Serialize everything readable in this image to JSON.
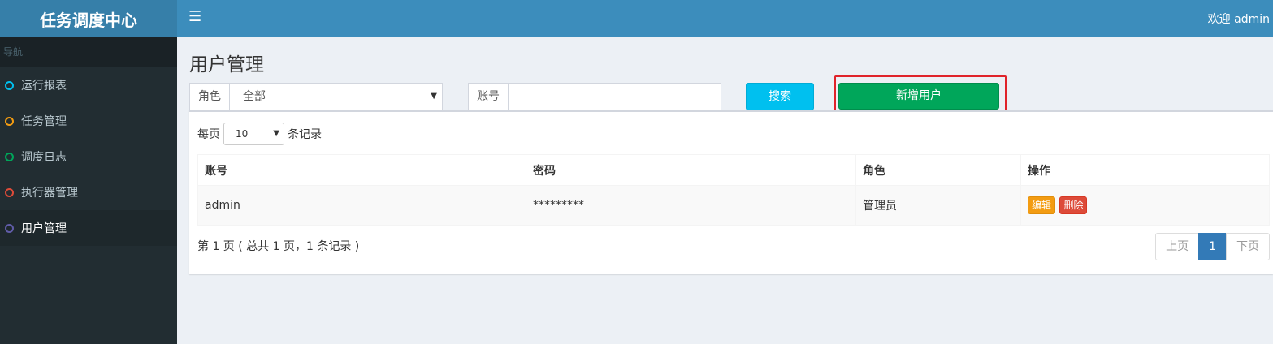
{
  "app": {
    "title": "任务调度中心"
  },
  "sidebar": {
    "header": "导航",
    "items": [
      {
        "label": "运行报表",
        "color": "#3c8dbc"
      },
      {
        "label": "任务管理",
        "color": "#f39c12"
      },
      {
        "label": "调度日志",
        "color": "#00a65a"
      },
      {
        "label": "执行器管理",
        "color": "#dd4b39"
      },
      {
        "label": "用户管理",
        "color": "#605ca8"
      }
    ],
    "active_index": 4
  },
  "header": {
    "menu_icon": "bars-icon",
    "welcome": "欢迎 admin"
  },
  "main": {
    "title": "用户管理",
    "filters": {
      "role_label": "角色",
      "role_value": "全部",
      "account_label": "账号",
      "account_value": ""
    },
    "search_label": "搜索",
    "add_label": "新增用户",
    "length": {
      "prefix": "每页",
      "value": "10",
      "suffix": "条记录"
    },
    "table": {
      "columns": [
        "账号",
        "密码",
        "角色",
        "操作"
      ],
      "rows": [
        {
          "account": "admin",
          "password": "*********",
          "role": "管理员",
          "edit_label": "编辑",
          "delete_label": "删除"
        }
      ]
    },
    "info": "第 1 页 ( 总共 1 页，1 条记录 )",
    "pagination": {
      "prev": "上页",
      "current": "1",
      "next": "下页"
    }
  }
}
